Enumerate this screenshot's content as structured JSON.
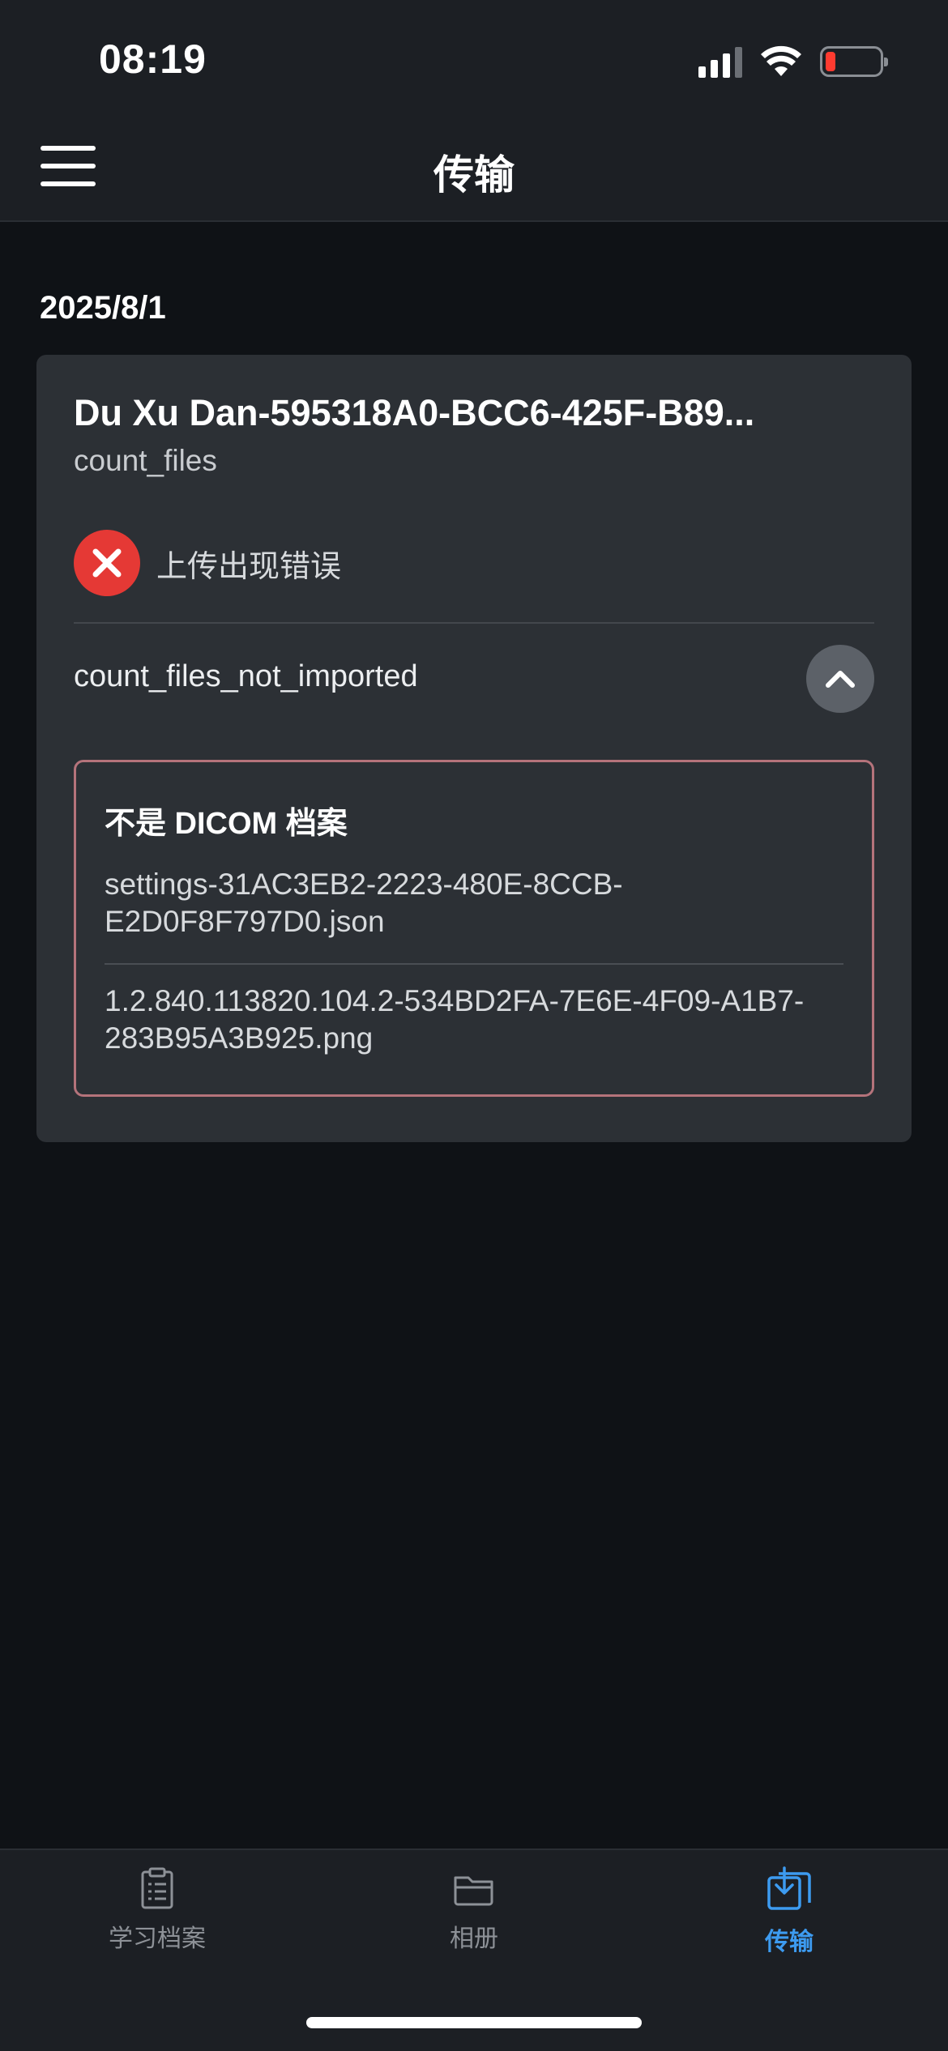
{
  "status_bar": {
    "time": "08:19"
  },
  "header": {
    "title": "传输"
  },
  "transfers": {
    "date": "2025/8/1",
    "card": {
      "title": "Du Xu Dan-595318A0-BCC6-425F-B89...",
      "subtitle": "count_files",
      "error_text": "上传出现错误",
      "collapse_label": "count_files_not_imported",
      "error_box": {
        "title": "不是 DICOM 档案",
        "files": [
          "settings-31AC3EB2-2223-480E-8CCB-E2D0F8F797D0.json",
          "1.2.840.113820.104.2-534BD2FA-7E6E-4F09-A1B7-283B95A3B925.png"
        ]
      }
    }
  },
  "tabbar": {
    "items": [
      {
        "label": "学习档案",
        "icon": "clipboard-icon"
      },
      {
        "label": "相册",
        "icon": "folder-icon"
      },
      {
        "label": "传输",
        "icon": "download-icon",
        "active": true
      }
    ]
  },
  "colors": {
    "accent": "#3d9bf0",
    "error": "#e53935",
    "error_border": "#b5737b"
  }
}
